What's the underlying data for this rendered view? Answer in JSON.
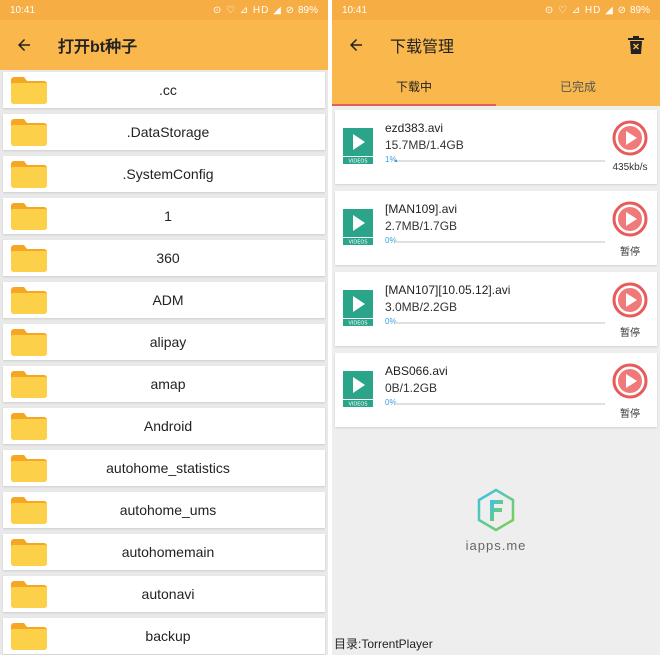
{
  "status_bar": {
    "time": "10:41",
    "icons_text": "⊙ ♡ ⊿ HD ◢ ⊘",
    "battery": "89%"
  },
  "left": {
    "title": "打开bt种子",
    "files": [
      ".cc",
      ".DataStorage",
      ".SystemConfig",
      "1",
      "360",
      "ADM",
      "alipay",
      "amap",
      "Android",
      "autohome_statistics",
      "autohome_ums",
      "autohomemain",
      "autonavi",
      "backup"
    ]
  },
  "right": {
    "title": "下载管理",
    "tabs": [
      "下载中",
      "已完成"
    ],
    "downloads": [
      {
        "name": "ezd383.avi",
        "size": "15.7MB/1.4GB",
        "percent": "1%",
        "progress": 0.01,
        "status": "435kb/s"
      },
      {
        "name": "[MAN109].avi",
        "size": "2.7MB/1.7GB",
        "percent": "0%",
        "progress": 0,
        "status": "暂停"
      },
      {
        "name": "[MAN107][10.05.12].avi",
        "size": "3.0MB/2.2GB",
        "percent": "0%",
        "progress": 0,
        "status": "暂停"
      },
      {
        "name": "ABS066.avi",
        "size": "0B/1.2GB",
        "percent": "0%",
        "progress": 0,
        "status": "暂停"
      }
    ],
    "watermark": "iapps.me",
    "footer": "目录:TorrentPlayer"
  },
  "colors": {
    "accent": "#f9b74c",
    "progress": "#3b9de0",
    "play": "#e85b5b",
    "video_icon": "#2aa58a"
  },
  "icons": {
    "back": "arrow-left-icon",
    "trash": "trash-icon",
    "folder": "folder-icon",
    "video": "video-file-icon",
    "play": "play-circle-icon"
  }
}
